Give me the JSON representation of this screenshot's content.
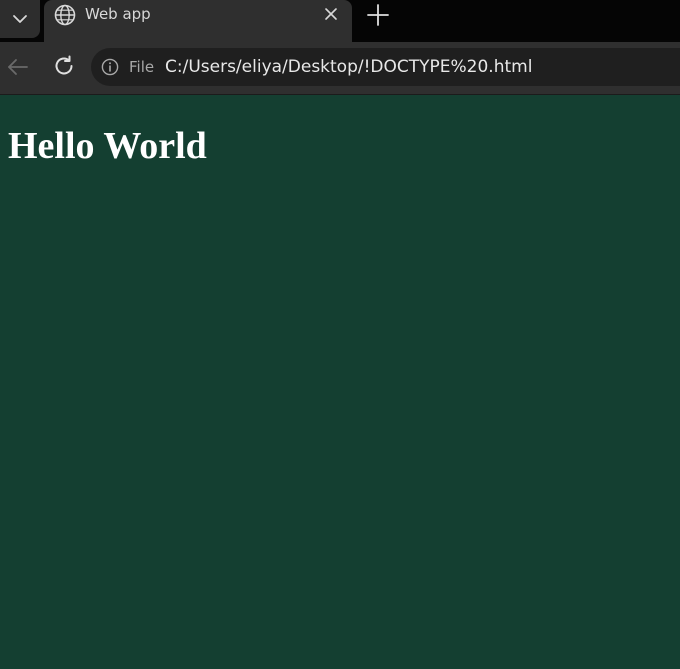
{
  "window": {
    "tab": {
      "title": "Web app",
      "icon": "globe-icon"
    },
    "icons": {
      "tab_list": "chevron-down-icon",
      "close_tab": "close-icon",
      "new_tab": "plus-icon",
      "back": "arrow-left-icon",
      "reload": "reload-icon",
      "site_info": "info-icon"
    }
  },
  "address_bar": {
    "scheme_label": "File",
    "url": "C:/Users/eliya/Desktop/!DOCTYPE%20.html"
  },
  "page": {
    "heading": "Hello World",
    "background_color": "#143f31",
    "heading_color": "#ffffff"
  }
}
